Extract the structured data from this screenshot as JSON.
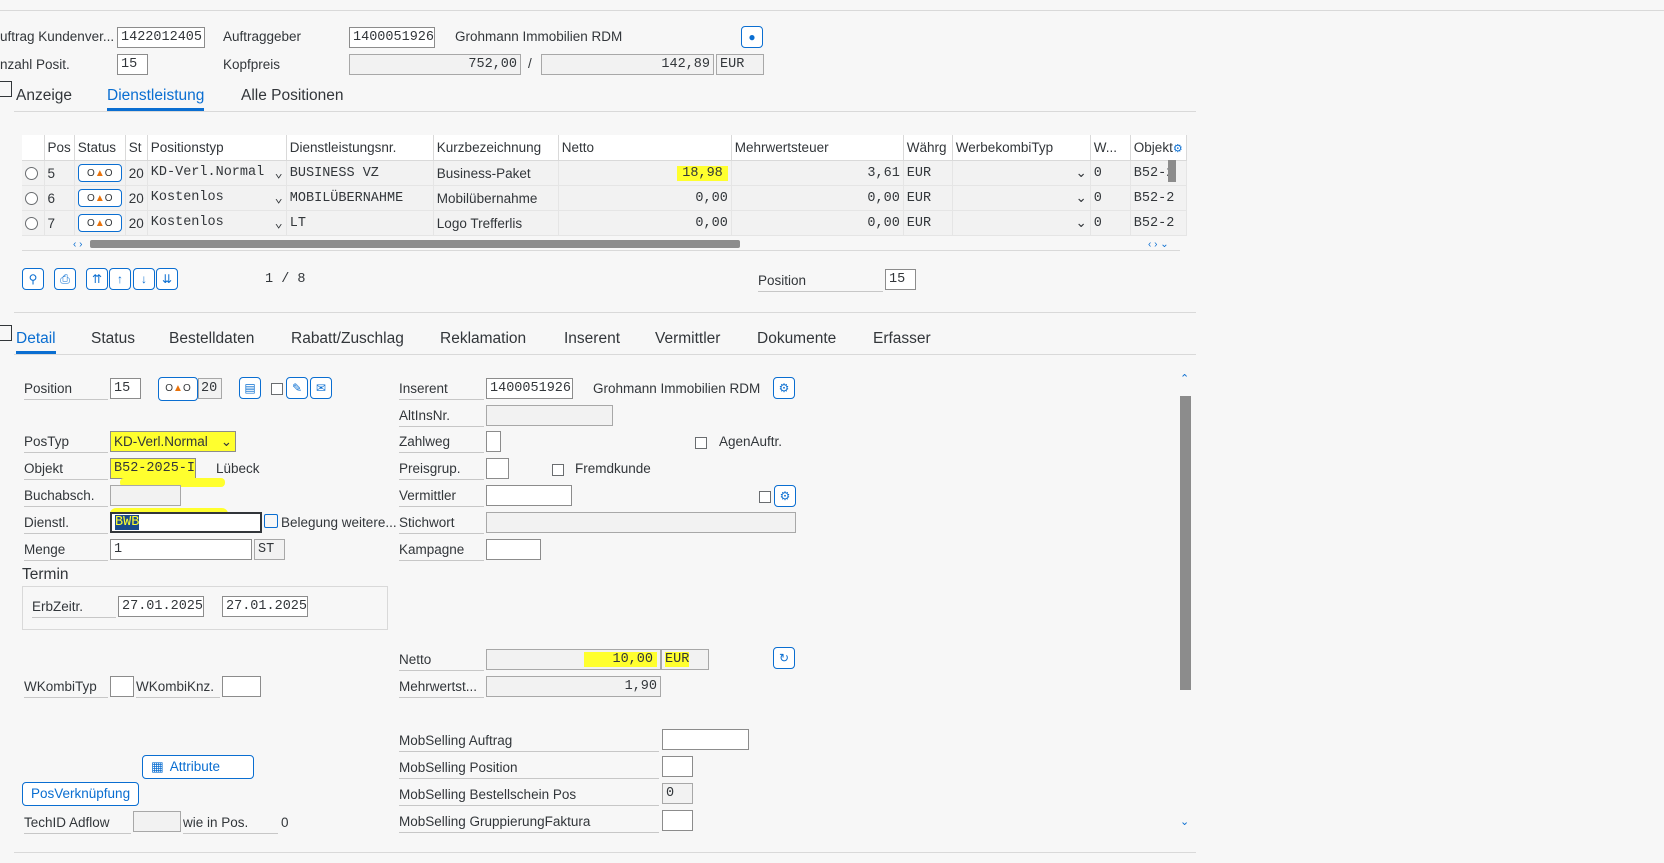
{
  "header": {
    "auftrag_label": "uftrag Kundenver...",
    "auftrag_value": "1422012405",
    "auftraggeber_label": "Auftraggeber",
    "auftraggeber_value": "1400051926",
    "auftraggeber_name": "Grohmann Immobilien RDM",
    "anzahl_label": "nzahl Posit.",
    "anzahl_value": "15",
    "kopfpreis_label": "Kopfpreis",
    "kopfpreis_value": "752,00",
    "kopfpreis_slash": "/",
    "kopfpreis_value2": "142,89",
    "currency": "EUR"
  },
  "top_tabs": [
    "Anzeige",
    "Dienstleistung",
    "Alle Positionen"
  ],
  "grid": {
    "columns": [
      "Pos",
      "Status",
      "St",
      "Positionstyp",
      "Dienstleistungsnr.",
      "Kurzbezeichnung",
      "Netto",
      "Mehrwertsteuer",
      "Währg",
      "WerbekombiTyp",
      "W...",
      "Objekt"
    ],
    "rows": [
      {
        "pos": "5",
        "st": "20",
        "typ": "KD-Verl.Normal",
        "dnr": "BUSINESS VZ",
        "kurz": "Business-Paket",
        "netto": "18,98",
        "mwst": "3,61",
        "waehrg": "EUR",
        "w": "0",
        "obj": "B52-2"
      },
      {
        "pos": "6",
        "st": "20",
        "typ": "Kostenlos",
        "dnr": "MOBILÜBERNAHME",
        "kurz": "Mobilübernahme",
        "netto": "0,00",
        "mwst": "0,00",
        "waehrg": "EUR",
        "w": "0",
        "obj": "B52-2"
      },
      {
        "pos": "7",
        "st": "20",
        "typ": "Kostenlos",
        "dnr": "LT",
        "kurz": "Logo Trefferlis",
        "netto": "0,00",
        "mwst": "0,00",
        "waehrg": "EUR",
        "w": "0",
        "obj": "B52-2"
      }
    ],
    "page_info": "1 / 8",
    "position_label": "Position",
    "position_value": "15"
  },
  "detail_tabs": [
    "Detail",
    "Status",
    "Bestelldaten",
    "Rabatt/Zuschlag",
    "Reklamation",
    "Inserent",
    "Vermittler",
    "Dokumente",
    "Erfasser"
  ],
  "detail": {
    "position_label": "Position",
    "position_value": "15",
    "status_value": "20",
    "postyp_label": "PosTyp",
    "postyp_value": "KD-Verl.Normal",
    "objekt_label": "Objekt",
    "objekt_value": "B52-2025-I",
    "objekt_ort": "Lübeck",
    "buchabsch_label": "Buchabsch.",
    "dienstl_label": "Dienstl.",
    "dienstl_value": "BWB",
    "belegung_label": "Belegung weitere...",
    "menge_label": "Menge",
    "menge_value": "1",
    "menge_unit": "ST",
    "termin_label": "Termin",
    "erbzeitr_label": "ErbZeitr.",
    "erbzeitr_from": "27.01.2025",
    "erbzeitr_to": "27.01.2025",
    "wkombityp_label": "WKombiTyp",
    "wkombiknz_label": "WKombiKnz.",
    "attribute_label": "Attribute",
    "posverk_label": "PosVerknüpfung",
    "techid_label": "TechID Adflow",
    "wieinpos_label": "wie in Pos.",
    "wieinpos_value": "0",
    "inserent_label": "Inserent",
    "inserent_value": "1400051926",
    "inserent_name": "Grohmann Immobilien RDM",
    "altinsnr_label": "AltInsNr.",
    "zahlweg_label": "Zahlweg",
    "agenauftr_label": "AgenAuftr.",
    "preisgrup_label": "Preisgrup.",
    "fremdkunde_label": "Fremdkunde",
    "vermittler_label": "Vermittler",
    "stichwort_label": "Stichwort",
    "kampagne_label": "Kampagne",
    "netto_label": "Netto",
    "netto_value": "10,00",
    "netto_currency": "EUR",
    "mwst_label": "Mehrwertst...",
    "mwst_value": "1,90",
    "mob_auftrag_label": "MobSelling Auftrag",
    "mob_position_label": "MobSelling Position",
    "mob_bestell_label": "MobSelling Bestellschein Pos",
    "mob_bestell_value": "0",
    "mob_grupp_label": "MobSelling GruppierungFaktura"
  },
  "colors": {
    "accent": "#0a6ed1",
    "highlight": "#ffff2e"
  }
}
